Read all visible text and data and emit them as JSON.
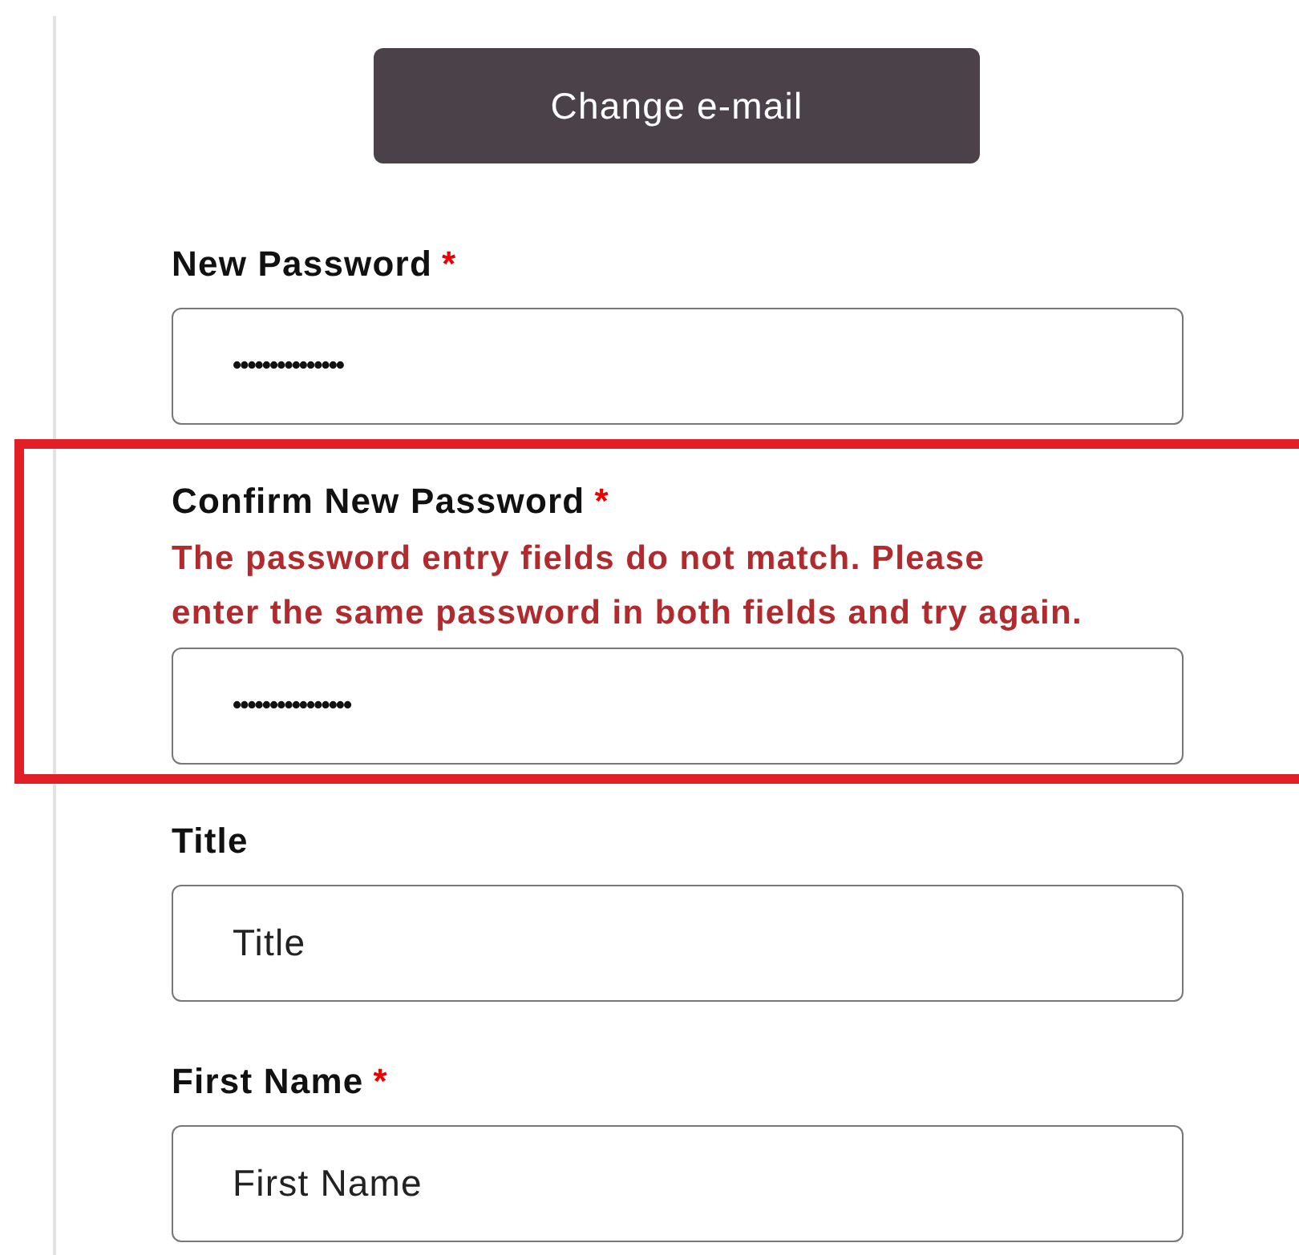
{
  "button": {
    "label": "Change e-mail"
  },
  "fields": [
    {
      "label": "New Password",
      "required_mark": "*",
      "value": "•••••••••••••••",
      "highlighted": false
    },
    {
      "label": "Confirm New Password",
      "required_mark": "*",
      "error": "The password entry fields do not match. Please\nenter the same password in both fields and try again.",
      "value": "••••••••••••••••",
      "highlighted": true
    },
    {
      "label": "Title",
      "placeholder": "Title",
      "highlighted": false
    },
    {
      "label": "First Name",
      "required_mark": "*",
      "placeholder": "First Name",
      "highlighted": false
    }
  ]
}
